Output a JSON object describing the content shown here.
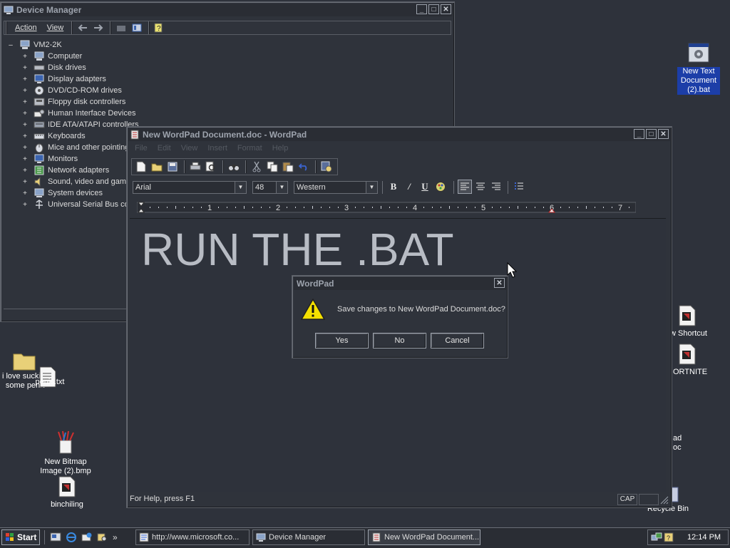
{
  "device_manager": {
    "title": "Device Manager",
    "menu": [
      "Action",
      "View"
    ],
    "root": "VM2-2K",
    "items": [
      "Computer",
      "Disk drives",
      "Display adapters",
      "DVD/CD-ROM drives",
      "Floppy disk controllers",
      "Human Interface Devices",
      "IDE ATA/ATAPI controllers",
      "Keyboards",
      "Mice and other pointing",
      "Monitors",
      "Network adapters",
      "Sound, video and game",
      "System devices",
      "Universal Serial Bus cor"
    ]
  },
  "wordpad": {
    "title": "New WordPad Document.doc - WordPad",
    "menu": [
      "File",
      "Edit",
      "View",
      "Insert",
      "Format",
      "Help"
    ],
    "font": "Arial",
    "size": "48",
    "script": "Western",
    "ruler_numbers": [
      "1",
      "2",
      "3",
      "4",
      "5",
      "6",
      "7"
    ],
    "document_text": "RUN THE .BAT",
    "status": "For Help, press F1",
    "caps": "CAP"
  },
  "dialog": {
    "title": "WordPad",
    "message": "Save changes to New WordPad Document.doc?",
    "yes": "Yes",
    "no": "No",
    "cancel": "Cancel"
  },
  "desktop": {
    "bat_icon": [
      "New Text",
      "Document",
      "(2).bat"
    ],
    "shortcut_icon": "w Shortcut",
    "fortnite_icon": "ORTNITE",
    "partial_icon": [
      "ad",
      "oc"
    ],
    "recycle_bin": "Recycle Bin",
    "folder_icon": [
      "i love sucking",
      "some penis"
    ],
    "txt_icon": "penis.txt",
    "bitmap_icon": [
      "New Bitmap",
      "Image (2).bmp"
    ],
    "binchiling_icon": "binchiling"
  },
  "taskbar": {
    "start": "Start",
    "quick_more": "»",
    "tasks": [
      "http://www.microsoft.co...",
      "Device Manager",
      "New WordPad Document...."
    ],
    "clock": "12:14 PM"
  }
}
